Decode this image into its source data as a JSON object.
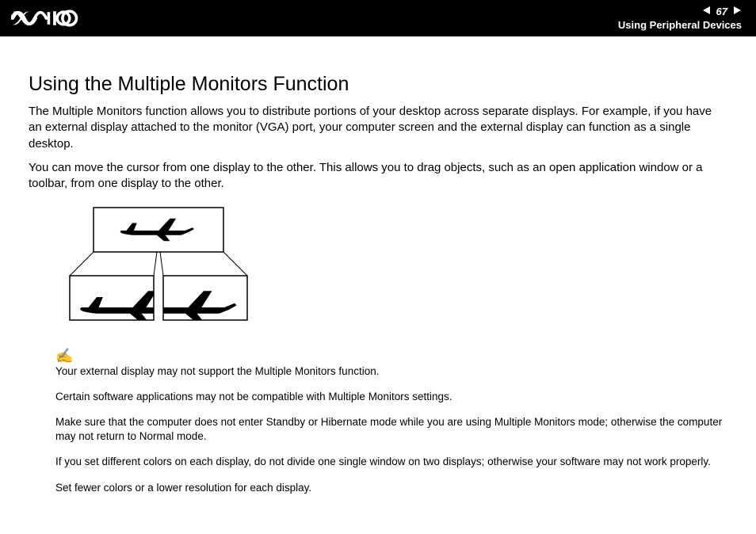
{
  "header": {
    "page_number": "67",
    "section": "Using Peripheral Devices"
  },
  "title": "Using the Multiple Monitors Function",
  "para1": "The Multiple Monitors function allows you to distribute portions of your desktop across separate displays. For example, if you have an external display attached to the monitor (VGA) port, your computer screen and the external display can function as a single desktop.",
  "para2": "You can move the cursor from one display to the other. This allows you to drag objects, such as an open application window or a toolbar, from one display to the other.",
  "notes": [
    "Your external display may not support the Multiple Monitors function.",
    "Certain software applications may not be compatible with Multiple Monitors settings.",
    "Make sure that the computer does not enter Standby or Hibernate mode while you are using Multiple Monitors mode; otherwise the computer may not return to Normal mode.",
    "If you set different colors on each display, do not divide one single window on two displays; otherwise your software may not work properly.",
    "Set fewer colors or a lower resolution for each display."
  ]
}
